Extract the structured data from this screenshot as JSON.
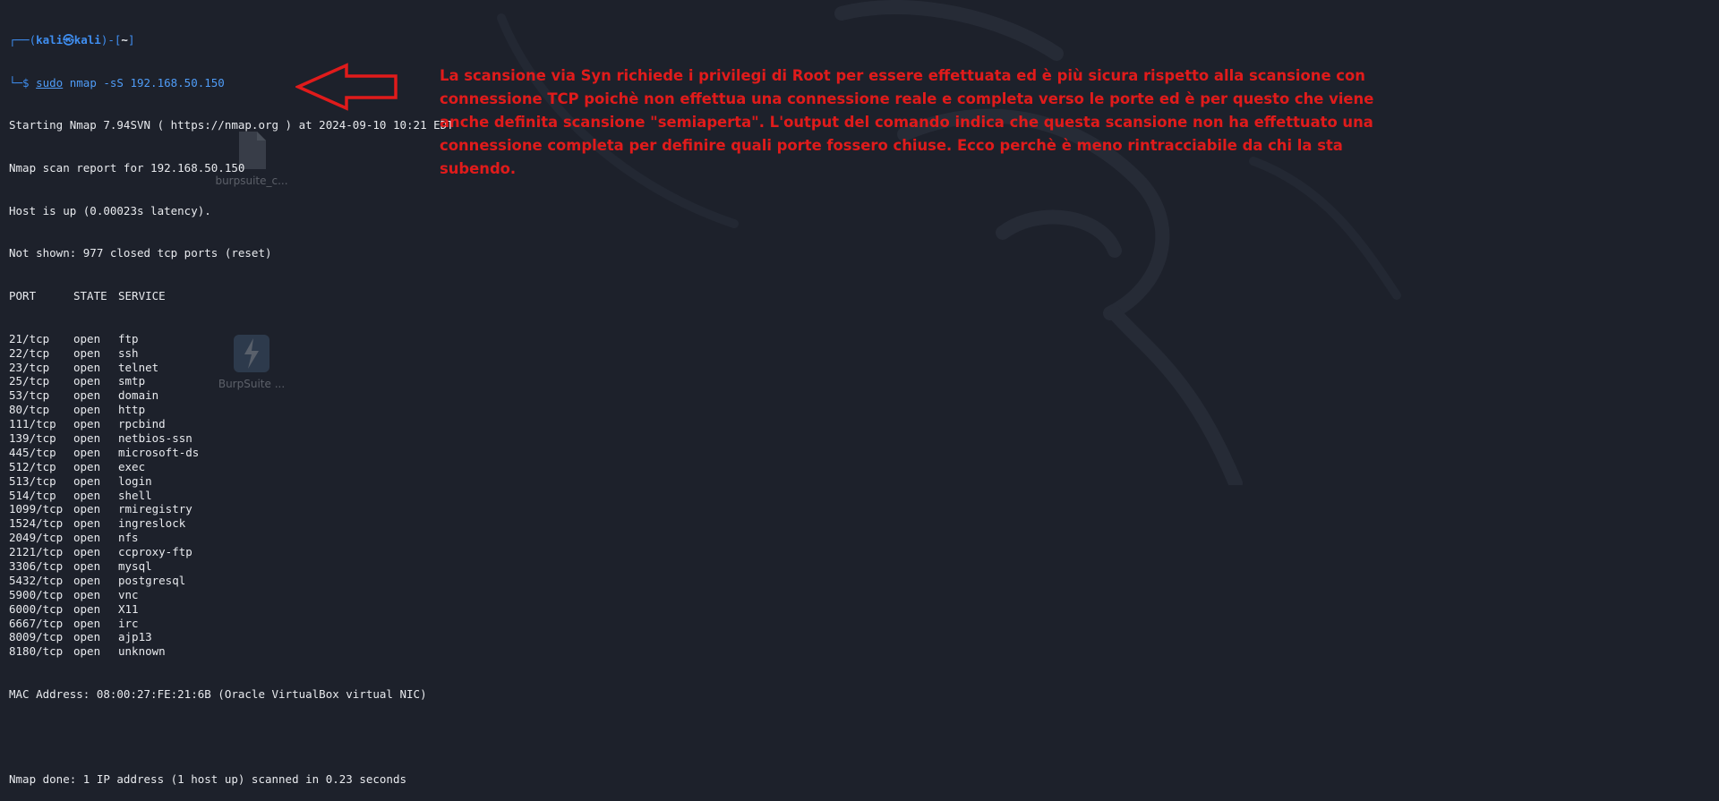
{
  "prompt": {
    "frame_open": "┌──(",
    "user": "kali㉿kali",
    "frame_mid": ")-[",
    "dir": "~",
    "frame_close": "]",
    "line2_prefix": "└─$ ",
    "cmd_sudo": "sudo",
    "cmd_rest": " nmap -sS 192.168.50.150"
  },
  "output_header": [
    "Starting Nmap 7.94SVN ( https://nmap.org ) at 2024-09-10 10:21 EDT",
    "Nmap scan report for 192.168.50.150",
    "Host is up (0.00023s latency).",
    "Not shown: 977 closed tcp ports (reset)"
  ],
  "ports_header": {
    "port": "PORT",
    "state": "STATE",
    "service": "SERVICE"
  },
  "ports": [
    {
      "port": "21/tcp",
      "state": "open",
      "service": "ftp"
    },
    {
      "port": "22/tcp",
      "state": "open",
      "service": "ssh"
    },
    {
      "port": "23/tcp",
      "state": "open",
      "service": "telnet"
    },
    {
      "port": "25/tcp",
      "state": "open",
      "service": "smtp"
    },
    {
      "port": "53/tcp",
      "state": "open",
      "service": "domain"
    },
    {
      "port": "80/tcp",
      "state": "open",
      "service": "http"
    },
    {
      "port": "111/tcp",
      "state": "open",
      "service": "rpcbind"
    },
    {
      "port": "139/tcp",
      "state": "open",
      "service": "netbios-ssn"
    },
    {
      "port": "445/tcp",
      "state": "open",
      "service": "microsoft-ds"
    },
    {
      "port": "512/tcp",
      "state": "open",
      "service": "exec"
    },
    {
      "port": "513/tcp",
      "state": "open",
      "service": "login"
    },
    {
      "port": "514/tcp",
      "state": "open",
      "service": "shell"
    },
    {
      "port": "1099/tcp",
      "state": "open",
      "service": "rmiregistry"
    },
    {
      "port": "1524/tcp",
      "state": "open",
      "service": "ingreslock"
    },
    {
      "port": "2049/tcp",
      "state": "open",
      "service": "nfs"
    },
    {
      "port": "2121/tcp",
      "state": "open",
      "service": "ccproxy-ftp"
    },
    {
      "port": "3306/tcp",
      "state": "open",
      "service": "mysql"
    },
    {
      "port": "5432/tcp",
      "state": "open",
      "service": "postgresql"
    },
    {
      "port": "5900/tcp",
      "state": "open",
      "service": "vnc"
    },
    {
      "port": "6000/tcp",
      "state": "open",
      "service": "X11"
    },
    {
      "port": "6667/tcp",
      "state": "open",
      "service": "irc"
    },
    {
      "port": "8009/tcp",
      "state": "open",
      "service": "ajp13"
    },
    {
      "port": "8180/tcp",
      "state": "open",
      "service": "unknown"
    }
  ],
  "mac_line": "MAC Address: 08:00:27:FE:21:6B (Oracle VirtualBox virtual NIC)",
  "done_line": "Nmap done: 1 IP address (1 host up) scanned in 0.23 seconds",
  "desktop_icons": [
    {
      "label": "burpsuite_c...",
      "icon": "file-icon"
    },
    {
      "label": "BurpSuite ...",
      "icon": "burpsuite-icon"
    }
  ],
  "annotation": {
    "color": "#e01b1b",
    "lines": [
      "La scansione via Syn richiede i privilegi di Root per essere effettuata ed è più sicura rispetto alla scansione con",
      "connessione TCP poichè non effettua una connessione reale e completa verso le porte ed è per questo che viene",
      "anche definita scansione \"semiaperta\". L'output del comando indica che questa scansione non ha effettuato una",
      "connessione completa per definire quali porte fossero chiuse. Ecco perchè è meno rintracciabile da chi la sta subendo."
    ]
  },
  "colors": {
    "background": "#1d212b",
    "terminal_text": "#e8eaee",
    "prompt_blue": "#3f8ef0"
  }
}
